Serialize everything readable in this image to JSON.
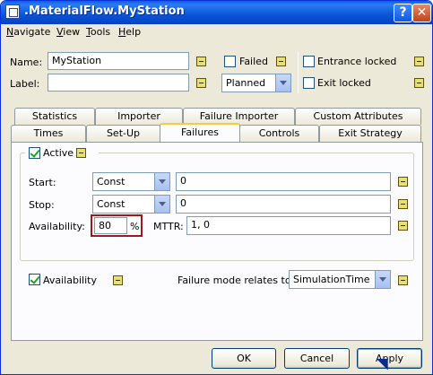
{
  "window": {
    "title": ".MaterialFlow.MyStation"
  },
  "menu": [
    {
      "label": "Navigate",
      "u": "N"
    },
    {
      "label": "View",
      "u": "V"
    },
    {
      "label": "Tools",
      "u": "T"
    },
    {
      "label": "Help",
      "u": "H"
    }
  ],
  "header": {
    "name_label": "Name:",
    "name_value": "MyStation",
    "label_label": "Label:",
    "label_value": "",
    "failed_label": "Failed",
    "failed_checked": false,
    "planned_value": "Planned",
    "entrance_locked_label": "Entrance locked",
    "entrance_locked_checked": false,
    "exit_locked_label": "Exit locked",
    "exit_locked_checked": false
  },
  "tabs": {
    "row1": [
      "Statistics",
      "Importer",
      "Failure Importer",
      "Custom Attributes"
    ],
    "row2": [
      "Times",
      "Set-Up",
      "Failures",
      "Controls",
      "Exit Strategy"
    ],
    "active": "Failures"
  },
  "failures": {
    "active_label": "Active",
    "active_checked": true,
    "start_label": "Start:",
    "start_dist": "Const",
    "start_value": "0",
    "stop_label": "Stop:",
    "stop_dist": "Const",
    "stop_value": "0",
    "availability_label": "Availability:",
    "availability_value": "80",
    "percent_label": "%",
    "mttr_label": "MTTR:",
    "mttr_value": "1, 0",
    "availability_check_label": "Availability",
    "availability_checked": true,
    "relates_label": "Failure mode relates to:",
    "relates_value": "SimulationTime"
  },
  "buttons": {
    "ok": "OK",
    "cancel": "Cancel",
    "apply": "Apply"
  },
  "colors": {
    "titlebar": "#0a5fe5",
    "highlight_border": "#a01818",
    "indicator": "#e8e070"
  }
}
